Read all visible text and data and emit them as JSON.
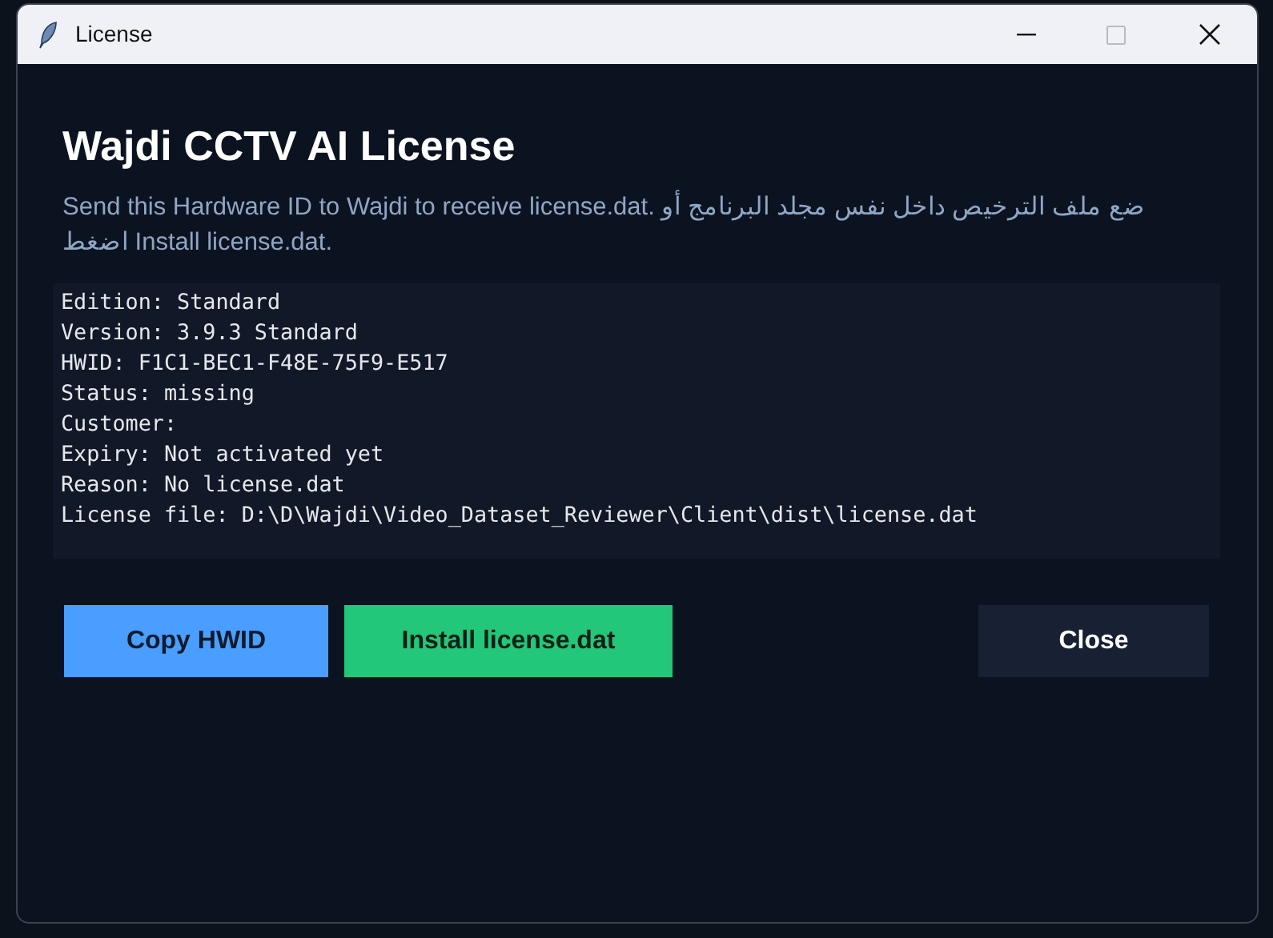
{
  "window": {
    "title": "License"
  },
  "heading": "Wajdi CCTV AI License",
  "instructions": "Send this Hardware ID to Wajdi to receive license.dat. ضع ملف الترخيص داخل نفس مجلد البرنامج أو اضغط Install license.dat.",
  "info_lines": [
    "Edition: Standard",
    "Version: 3.9.3 Standard",
    "HWID: F1C1-BEC1-F48E-75F9-E517",
    "Status: missing",
    "Customer:",
    "Expiry: Not activated yet",
    "Reason: No license.dat",
    "License file: D:\\D\\Wajdi\\Video_Dataset_Reviewer\\Client\\dist\\license.dat"
  ],
  "buttons": [
    {
      "label": "Copy HWID",
      "kind": "primary"
    },
    {
      "label": "Install license.dat",
      "kind": "success"
    },
    {
      "label": "Close",
      "kind": "secondary"
    }
  ]
}
